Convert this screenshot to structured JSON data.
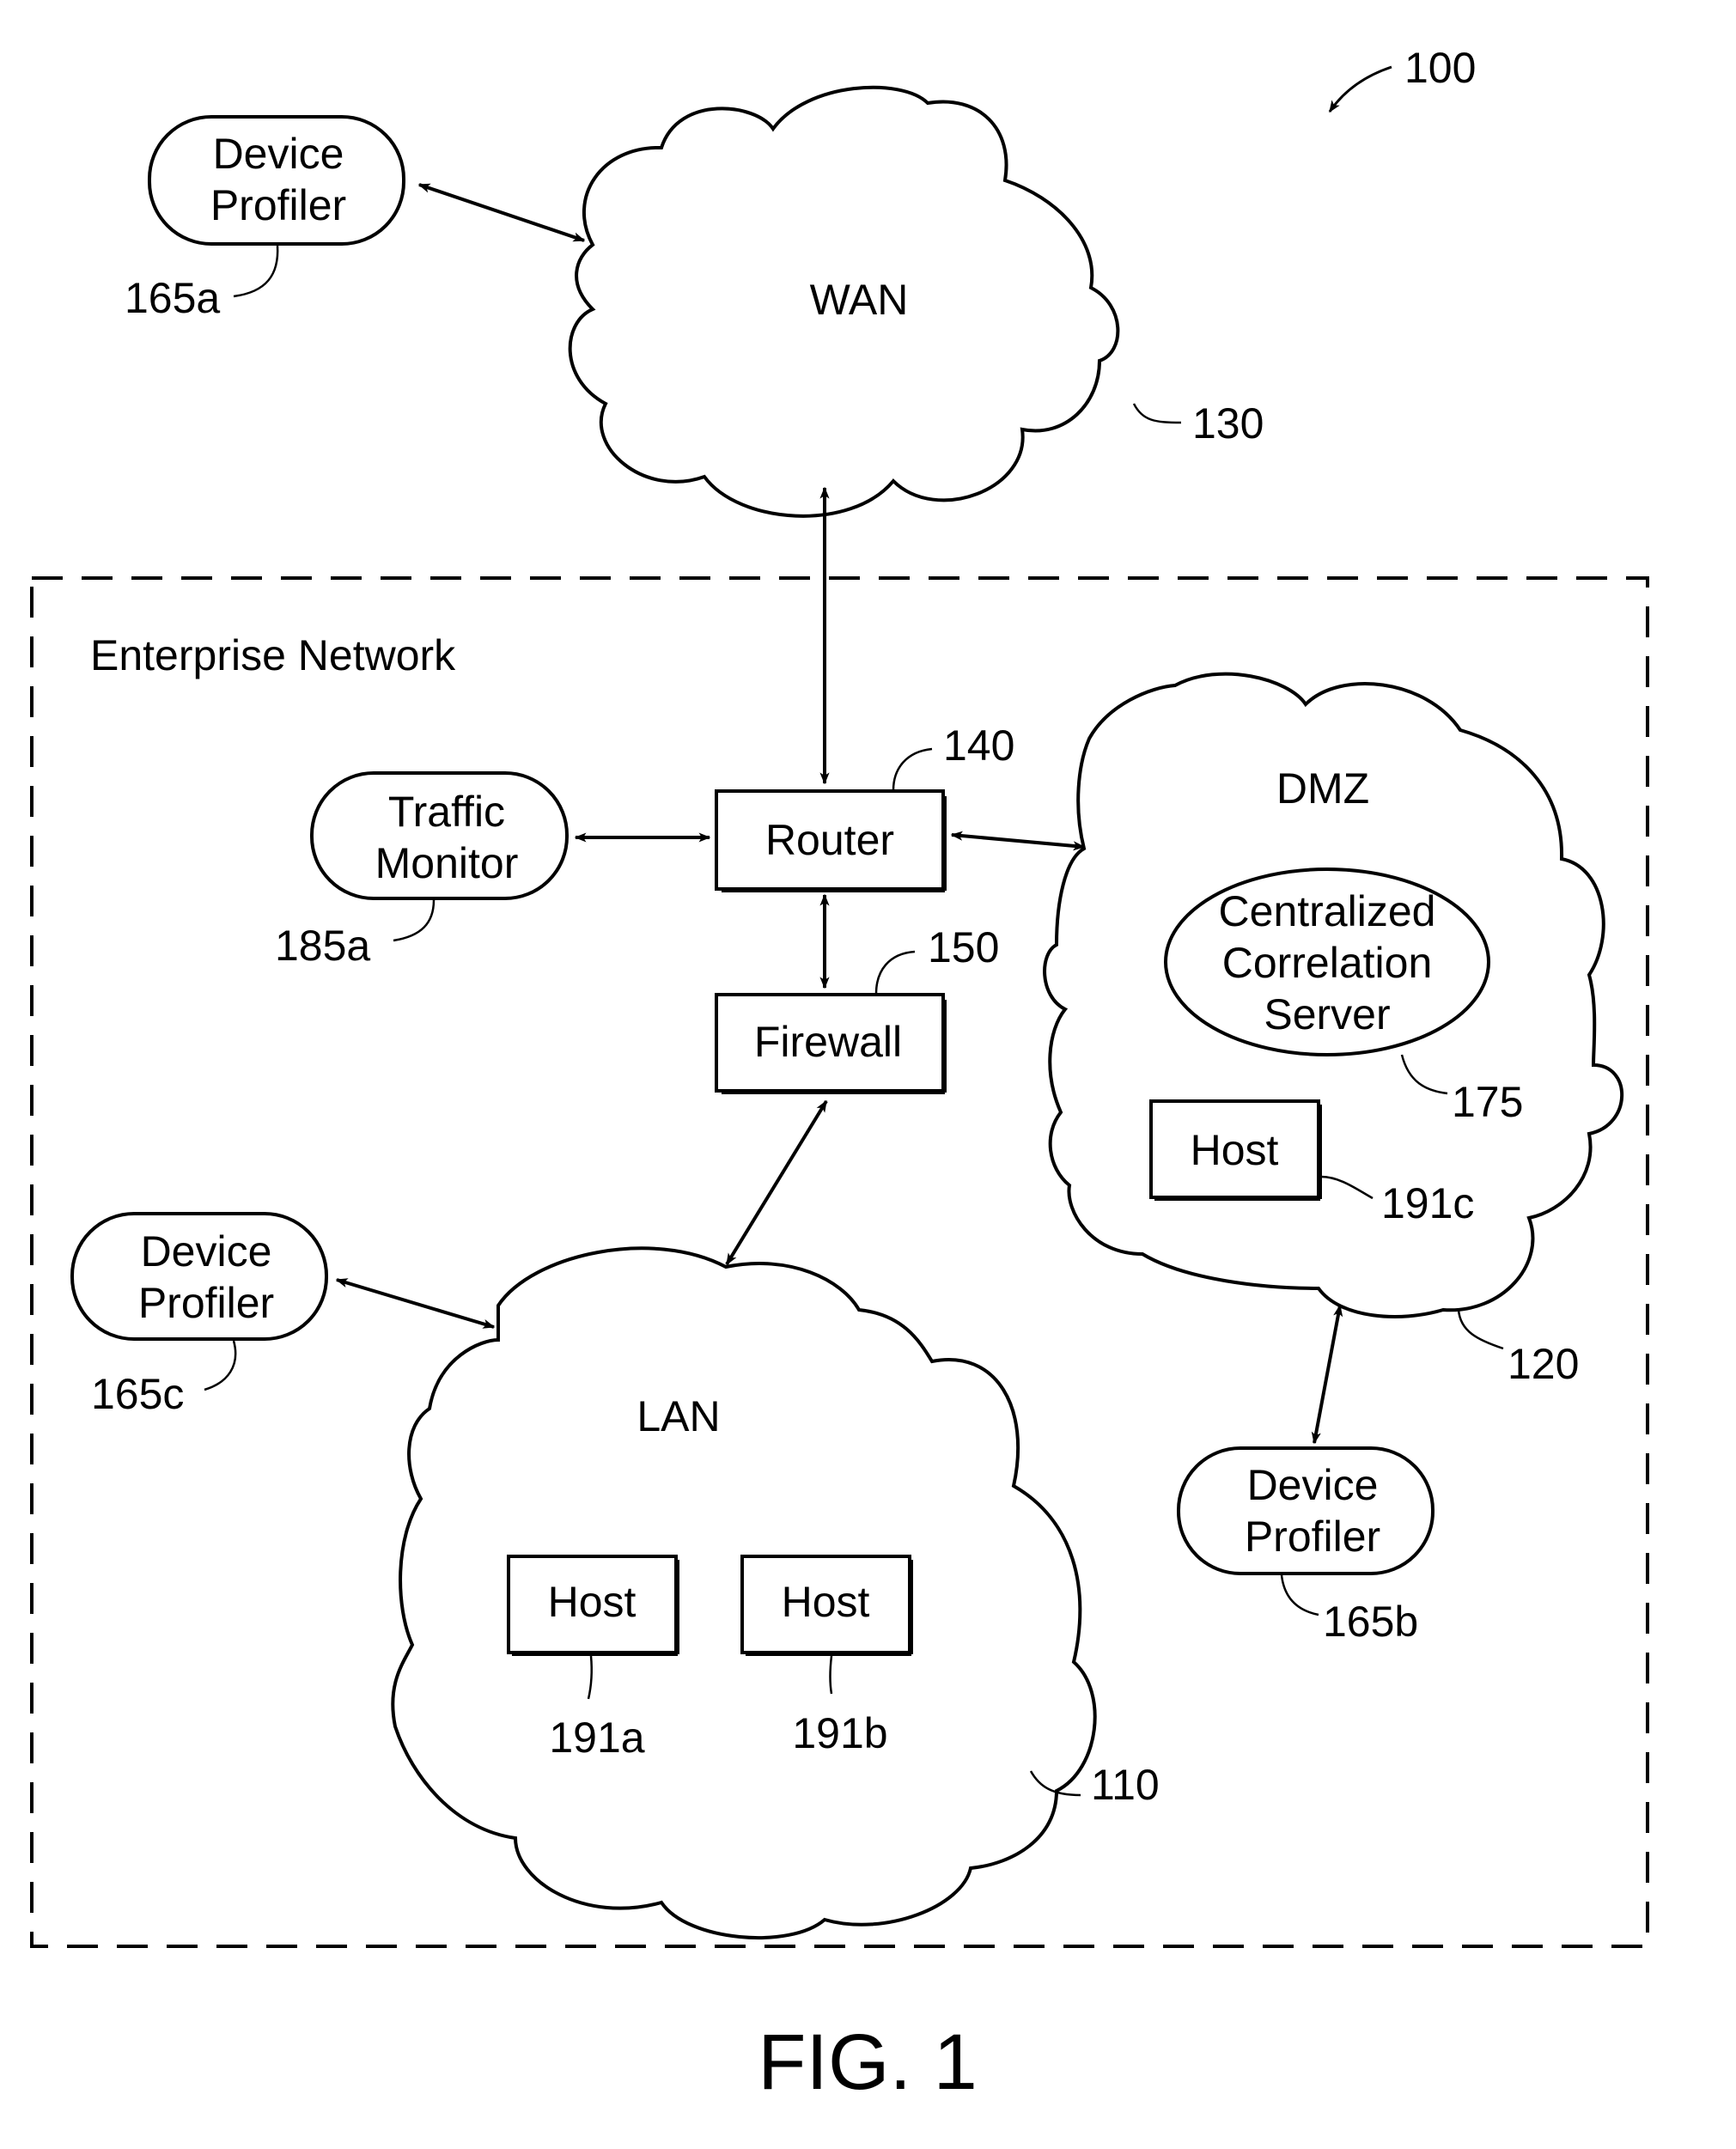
{
  "figure": {
    "ref": "100",
    "caption": "FIG. 1"
  },
  "wan": {
    "name": "WAN",
    "ref": "130"
  },
  "enterprise": {
    "name": "Enterprise Network"
  },
  "router": {
    "name": "Router",
    "ref": "140"
  },
  "firewall": {
    "name": "Firewall",
    "ref": "150"
  },
  "traffic_monitor": {
    "line1": "Traffic",
    "line2": "Monitor",
    "ref": "185a"
  },
  "dmz": {
    "name": "DMZ",
    "ref": "120",
    "server": {
      "line1": "Centralized",
      "line2": "Correlation",
      "line3": "Server",
      "ref": "175"
    },
    "host": {
      "name": "Host",
      "ref": "191c"
    }
  },
  "lan": {
    "name": "LAN",
    "ref": "110",
    "hosts": [
      {
        "name": "Host",
        "ref": "191a"
      },
      {
        "name": "Host",
        "ref": "191b"
      }
    ]
  },
  "device_profilers": [
    {
      "line1": "Device",
      "line2": "Profiler",
      "ref": "165a"
    },
    {
      "line1": "Device",
      "line2": "Profiler",
      "ref": "165b"
    },
    {
      "line1": "Device",
      "line2": "Profiler",
      "ref": "165c"
    }
  ],
  "connections": [
    {
      "from": "Device Profiler 165a",
      "to": "WAN",
      "direction": "bidirectional"
    },
    {
      "from": "WAN",
      "to": "Router",
      "direction": "bidirectional"
    },
    {
      "from": "Traffic Monitor",
      "to": "Router",
      "direction": "bidirectional"
    },
    {
      "from": "Router",
      "to": "DMZ",
      "direction": "bidirectional"
    },
    {
      "from": "Router",
      "to": "Firewall",
      "direction": "bidirectional"
    },
    {
      "from": "Firewall",
      "to": "LAN",
      "direction": "bidirectional"
    },
    {
      "from": "Device Profiler 165c",
      "to": "LAN",
      "direction": "bidirectional"
    },
    {
      "from": "DMZ",
      "to": "Device Profiler 165b",
      "direction": "bidirectional"
    }
  ]
}
